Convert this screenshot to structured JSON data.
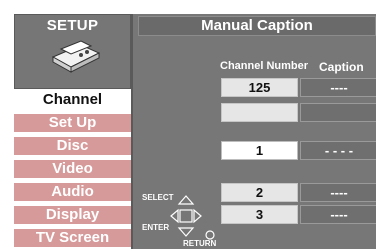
{
  "sidebar": {
    "title": "SETUP",
    "items": [
      {
        "label": "Channel",
        "active": true
      },
      {
        "label": "Set Up"
      },
      {
        "label": "Disc"
      },
      {
        "label": "Video"
      },
      {
        "label": "Audio"
      },
      {
        "label": "Display"
      },
      {
        "label": "TV Screen"
      }
    ]
  },
  "panel": {
    "title": "Manual Caption",
    "columns": {
      "channel": "Channel Number",
      "caption": "Caption"
    },
    "rows": [
      {
        "channel": "125",
        "caption": "----"
      },
      {
        "channel": "",
        "caption": ""
      },
      {
        "channel": "1",
        "caption": "- - - -"
      },
      {
        "channel": "2",
        "caption": "----"
      },
      {
        "channel": "3",
        "caption": "----"
      }
    ]
  },
  "navigation": {
    "select": "SELECT",
    "enter": "ENTER",
    "return": "RETURN"
  },
  "icons": [
    "setup-devices-icon",
    "dpad-icon",
    "return-circle-icon"
  ]
}
